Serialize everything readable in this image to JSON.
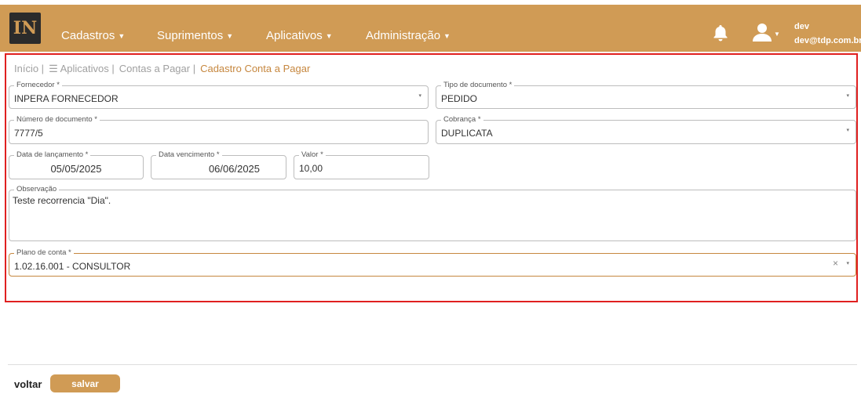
{
  "navbar": {
    "logo_text": "IN",
    "menu": [
      {
        "label": "Cadastros"
      },
      {
        "label": "Suprimentos"
      },
      {
        "label": "Aplicativos"
      },
      {
        "label": "Administração"
      }
    ],
    "user": {
      "name": "dev",
      "email": "dev@tdp.com.br"
    },
    "colors": {
      "brand": "#d09b55",
      "highlight": "#e02020",
      "accent": "#c6873f"
    }
  },
  "breadcrumb": {
    "items": [
      "Início |",
      "☰ Aplicativos |",
      "Contas a Pagar |"
    ],
    "current": "Cadastro Conta a Pagar"
  },
  "form": {
    "fornecedor": {
      "label": "Fornecedor *",
      "value": "INPERA FORNECEDOR"
    },
    "tipo_documento": {
      "label": "Tipo de documento *",
      "value": "PEDIDO"
    },
    "numero_documento": {
      "label": "Número de documento *",
      "value": "7777/5"
    },
    "cobranca": {
      "label": "Cobrança *",
      "value": "DUPLICATA"
    },
    "data_lancamento": {
      "label": "Data de lançamento *",
      "value": "05/05/2025"
    },
    "data_vencimento": {
      "label": "Data vencimento *",
      "value": "06/06/2025"
    },
    "valor": {
      "label": "Valor *",
      "value": "10,00"
    },
    "observacao": {
      "label": "Observação",
      "value": "Teste recorrencia \"Dia\"."
    },
    "plano_conta": {
      "label": "Plano de conta *",
      "value": "1.02.16.001 - CONSULTOR"
    }
  },
  "footer": {
    "back_label": "voltar",
    "save_label": "salvar"
  },
  "icons": {
    "dropdown": "▾",
    "clear": "×",
    "caret": "▼"
  }
}
